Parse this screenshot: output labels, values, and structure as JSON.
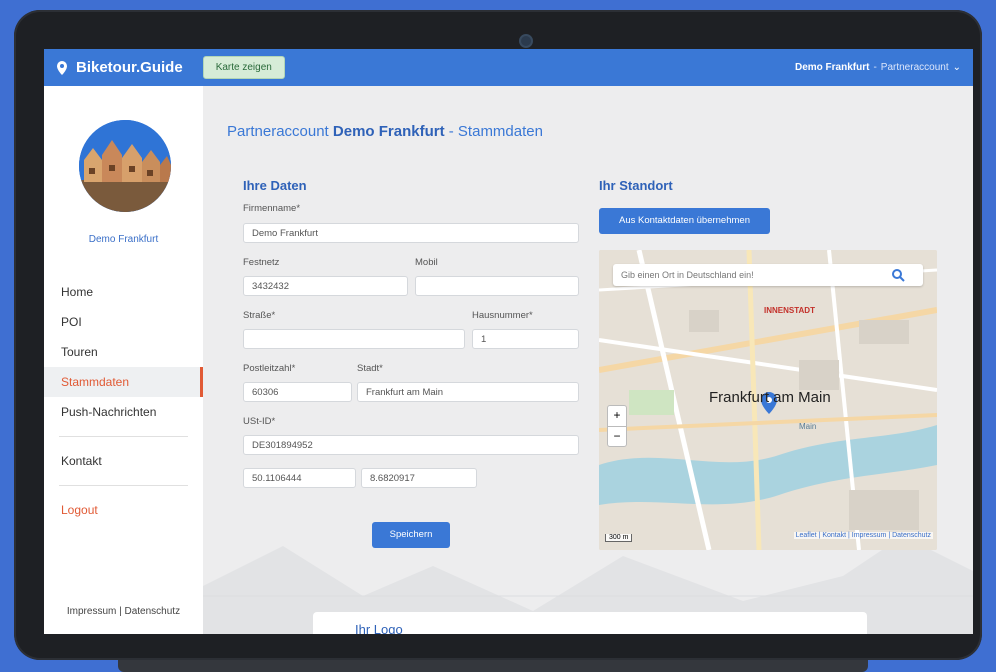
{
  "app": {
    "brand": "Biketour.Guide",
    "map_button": "Karte zeigen",
    "account_name": "Demo Frankfurt",
    "account_sep": " - ",
    "account_type": "Partneraccount",
    "account_caret": "⌄"
  },
  "sidebar": {
    "avatar_name": "Demo Frankfurt",
    "items": [
      {
        "label": "Home"
      },
      {
        "label": "POI"
      },
      {
        "label": "Touren"
      },
      {
        "label": "Stammdaten"
      },
      {
        "label": "Push-Nachrichten"
      }
    ],
    "contact": "Kontakt",
    "logout": "Logout",
    "footer": "Impressum | Datenschutz"
  },
  "page": {
    "title_prefix": "Partneraccount ",
    "title_name": "Demo Frankfurt",
    "title_suffix": " - Stammdaten"
  },
  "form": {
    "section_title": "Ihre Daten",
    "firmenname_label": "Firmenname*",
    "firmenname_value": "Demo Frankfurt",
    "festnetz_label": "Festnetz",
    "festnetz_value": "3432432",
    "mobil_label": "Mobil",
    "mobil_value": "",
    "strasse_label": "Straße*",
    "strasse_value": "",
    "hausnummer_label": "Hausnummer*",
    "hausnummer_value": "1",
    "plz_label": "Postleitzahl*",
    "plz_value": "60306",
    "stadt_label": "Stadt*",
    "stadt_value": "Frankfurt am Main",
    "ust_label": "USt-ID*",
    "ust_value": "DE301894952",
    "lat_value": "50.1106444",
    "lng_value": "8.6820917",
    "save_button": "Speichern"
  },
  "location": {
    "section_title": "Ihr Standort",
    "copy_button": "Aus Kontaktdaten übernehmen",
    "search_placeholder": "Gib einen Ort in Deutschland ein!",
    "city_label": "Frankfurt am Main",
    "district_label": "INNENSTADT",
    "river_label": "Main",
    "scale": "300 m",
    "attribution": "Leaflet | Kontakt | Impressum | Datenschutz",
    "zoom_in": "+",
    "zoom_out": "−"
  },
  "logo_section": {
    "title": "Ihr Logo"
  },
  "colors": {
    "brand": "#3a78d6",
    "accent": "#e15a35",
    "button_green": "#d6ecd7"
  }
}
